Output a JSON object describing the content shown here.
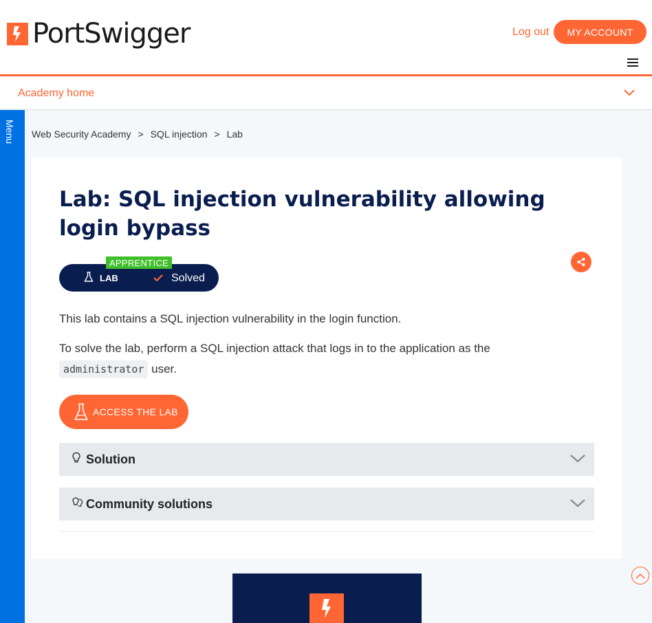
{
  "header": {
    "brand": "PortSwigger",
    "logout_label": "Log out",
    "account_label": "MY ACCOUNT"
  },
  "academy_bar": {
    "home_label": "Academy home"
  },
  "side_menu": {
    "label": "Menu"
  },
  "breadcrumb": {
    "items": [
      "Web Security Academy",
      "SQL injection",
      "Lab"
    ],
    "separator": ">"
  },
  "lab": {
    "title": "Lab: SQL injection vulnerability allowing login bypass",
    "level": "APPRENTICE",
    "type_label": "LAB",
    "status": "Solved",
    "description_1": "This lab contains a SQL injection vulnerability in the login function.",
    "description_2_before": "To solve the lab, perform a SQL injection attack that logs in to the application as the",
    "description_2_code": "administrator",
    "description_2_after": "user.",
    "access_label": "ACCESS THE LAB"
  },
  "accordions": [
    {
      "label": "Solution",
      "icon": "lightbulb-icon"
    },
    {
      "label": "Community solutions",
      "icon": "community-icon"
    }
  ],
  "colors": {
    "brand_orange": "#ff6633",
    "navy": "#0a1d4f",
    "menu_blue": "#0071e3",
    "apprentice_green": "#3fbf2a"
  }
}
